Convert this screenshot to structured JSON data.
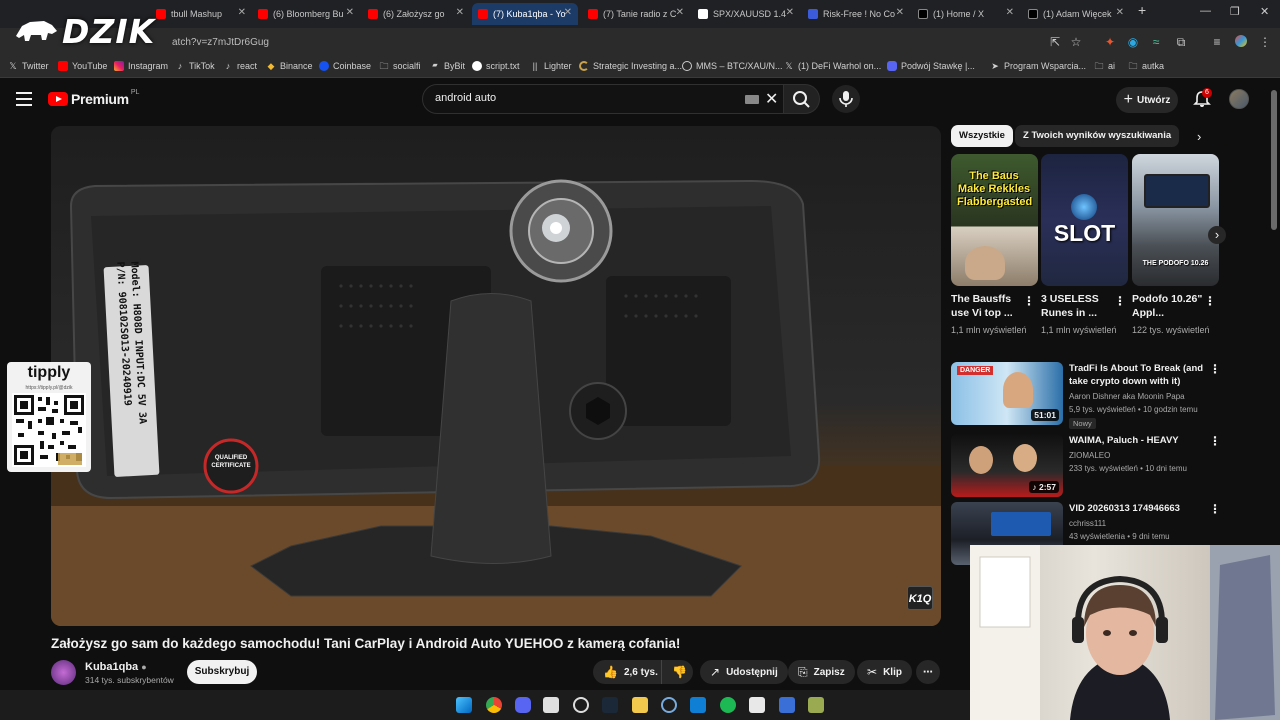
{
  "browser": {
    "tabs": [
      {
        "label": "tbull Mashup",
        "color": "#ff0000"
      },
      {
        "label": "(6) Bloomberg Bu",
        "color": "#ff0000"
      },
      {
        "label": "(6) Założysz go",
        "color": "#ff0000"
      },
      {
        "label": "(7) Kuba1qba - Yo",
        "color": "#ff0000"
      },
      {
        "label": "(7) Tanie radio z C",
        "color": "#ff0000"
      },
      {
        "label": "SPX/XAUUSD 1.4",
        "color": "#ffffff"
      },
      {
        "label": "Risk-Free ! No Co",
        "color": "#3b5bdb"
      },
      {
        "label": "(1) Home / X",
        "color": "#000000"
      },
      {
        "label": "(1) Adam Więcek",
        "color": "#000000"
      }
    ],
    "url": "atch?v=z7mJtDr6Gug",
    "bookmarks": [
      {
        "label": "Twitter",
        "icon": "x-icon"
      },
      {
        "label": "YouTube",
        "icon": "youtube-icon"
      },
      {
        "label": "Instagram",
        "icon": "instagram-icon"
      },
      {
        "label": "TikTok",
        "icon": "tiktok-icon"
      },
      {
        "label": "react",
        "icon": "tiktok-icon"
      },
      {
        "label": "Binance",
        "icon": "binance-icon"
      },
      {
        "label": "Coinbase",
        "icon": "coinbase-icon"
      },
      {
        "label": "socialfi",
        "icon": "folder-icon"
      },
      {
        "label": "ByBit",
        "icon": "bybit-icon"
      },
      {
        "label": "script.txt",
        "icon": "github-icon"
      },
      {
        "label": "Lighter",
        "icon": "lighter-icon"
      },
      {
        "label": "Strategic Investing a...",
        "icon": "spinner-icon"
      },
      {
        "label": "MMS – BTC/XAU/N...",
        "icon": "globe-icon"
      },
      {
        "label": "(1) DeFi Warhol on...",
        "icon": "x-icon"
      },
      {
        "label": "Podwój Stawkę |...",
        "icon": "discord-icon"
      },
      {
        "label": "Program Wsparcia...",
        "icon": "arrow-icon"
      },
      {
        "label": "ai",
        "icon": "folder-icon"
      },
      {
        "label": "autka",
        "icon": "folder-icon"
      }
    ]
  },
  "overlay": {
    "logo_text": "DZIK",
    "tipply_name": "tipply",
    "tipply_url": "https://tipply.pl/@dzik"
  },
  "header": {
    "logo_word": "Premium",
    "logo_region": "PL",
    "search_value": "android auto",
    "create_label": "Utwórz",
    "notif_count": "6"
  },
  "video": {
    "title": "Założysz go sam do każdego samochodu! Tani CarPlay i Android Auto YUEHOO z kamerą cofania!",
    "channel": "Kuba1qba",
    "subs": "314 tys. subskrybentów",
    "subscribe_label": "Subskrybuj",
    "likes": "2,6 tys.",
    "share_label": "Udostępnij",
    "save_label": "Zapisz",
    "clip_label": "Klip",
    "label_model": "Model: H808D  INPUT:DC 5V 3A",
    "label_pn": "P/N: 908102S013-20240919",
    "sticker_text": "QUALIFIED CERTIFICATE",
    "watermark": "K1Q"
  },
  "sidebar": {
    "chips": [
      "Wszystkie",
      "Z Twoich wyników wyszukiwania"
    ],
    "shorts": [
      {
        "title": "The Bausffs use Vi top ...",
        "views": "1,1 mln wyświetleń",
        "overlay": "The Baus Make Rekkles Flabbergasted"
      },
      {
        "title": "3 USELESS Runes in ...",
        "views": "1,1 mln wyświetleń",
        "overlay": "SLOT"
      },
      {
        "title": "Podofo 10.26\" Appl...",
        "views": "122 tys. wyświetleń",
        "overlay": "THE PODOFO 10.26"
      }
    ],
    "videos": [
      {
        "title": "TradFi Is About To Break (and take crypto down with it)",
        "channel": "Aaron Dishner aka Moonin Papa",
        "meta": "5,9 tys. wyświetleń • 10 godzin temu",
        "duration": "51:01",
        "badge": "Nowy",
        "thumb_text": "DANGER"
      },
      {
        "title": "WAIMA, Paluch - HEAVY",
        "channel": "ZIOMALEO",
        "meta": "233 tys. wyświetleń • 10 dni temu",
        "duration": "2:57"
      },
      {
        "title": "VID 20260313 174946663",
        "channel": "cchriss111",
        "meta": "43 wyświetlenia • 9 dni temu"
      }
    ]
  }
}
